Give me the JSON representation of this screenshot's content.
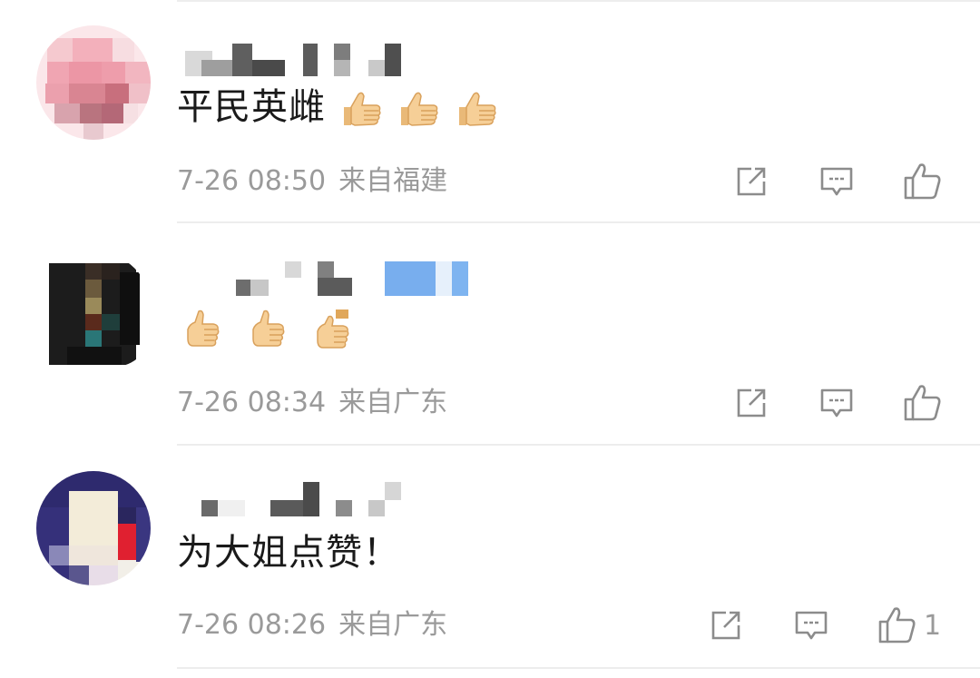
{
  "comments": [
    {
      "text": "平民英雌",
      "emoji_count": 3,
      "emoji_style": "thumbs-up",
      "time": "7-26 08:50",
      "location": "来自福建",
      "likes": ""
    },
    {
      "text": "",
      "emoji_count": 3,
      "emoji_style": "thumbs-up",
      "time": "7-26 08:34",
      "location": "来自广东",
      "likes": ""
    },
    {
      "text": "为大姐点赞！",
      "emoji_count": 0,
      "emoji_style": "",
      "time": "7-26 08:26",
      "location": "来自广东",
      "likes": "1"
    }
  ],
  "icons": {
    "repost": "repost-icon",
    "comment": "comment-icon",
    "like": "like-icon",
    "emoji": "thumbs-up-emoji"
  },
  "colors": {
    "text": "#1a1a1a",
    "meta": "#9a9a9a",
    "divider": "#ededed",
    "icon": "#8c8c8c"
  }
}
